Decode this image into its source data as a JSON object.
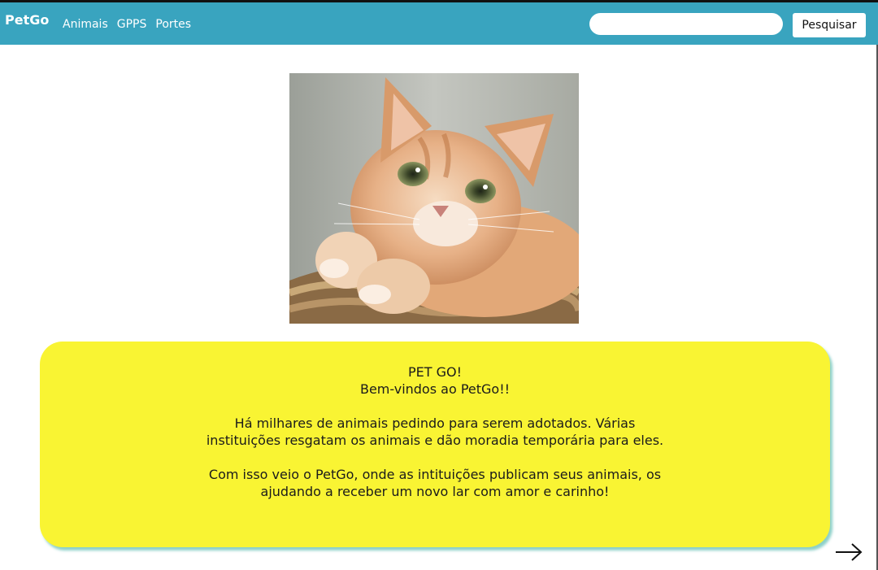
{
  "header": {
    "brand": "PetGo",
    "nav": [
      "Animais",
      "GPPS",
      "Portes"
    ],
    "search": {
      "value": "",
      "placeholder": "",
      "button_label": "Pesquisar"
    },
    "colors": {
      "bar": "#39a4bf"
    }
  },
  "hero": {
    "image": "orange-cat-photo"
  },
  "card": {
    "title": "PET GO!",
    "subtitle": "Bem-vindos ao PetGo!!",
    "paragraph1": "Há milhares de animais pedindo para serem adotados. Várias\ninstituições resgatam os animais e dão moradia temporária para eles.",
    "paragraph2": "Com isso veio o PetGo, onde as intituições publicam seus animais, os\najudando a receber um novo lar com amor e carinho!",
    "colors": {
      "background": "#f9f433",
      "shadow": "#78c8be"
    }
  },
  "footer": {
    "next_icon": "arrow-right-icon"
  }
}
